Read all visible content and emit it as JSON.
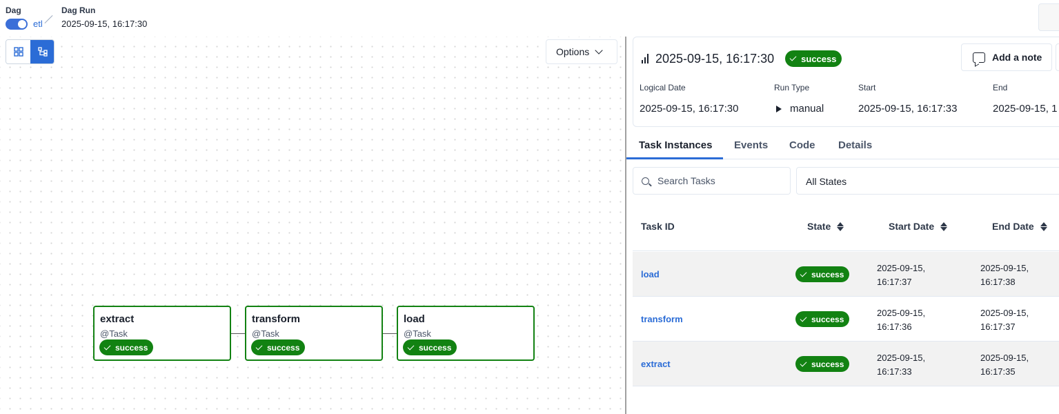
{
  "breadcrumb": {
    "dag_label": "Dag",
    "dag_id": "etl",
    "run_label": "Dag Run",
    "run_value": "2025-09-15, 16:17:30"
  },
  "graph": {
    "options_label": "Options",
    "nodes": [
      {
        "name": "extract",
        "operator": "@Task",
        "state": "success"
      },
      {
        "name": "transform",
        "operator": "@Task",
        "state": "success"
      },
      {
        "name": "load",
        "operator": "@Task",
        "state": "success"
      }
    ]
  },
  "run": {
    "title": "2025-09-15, 16:17:30",
    "state": "success",
    "add_note_label": "Add a note",
    "meta": {
      "logical_date_label": "Logical Date",
      "logical_date": "2025-09-15, 16:17:30",
      "run_type_label": "Run Type",
      "run_type": "manual",
      "start_label": "Start",
      "start": "2025-09-15, 16:17:33",
      "end_label": "End",
      "end": "2025-09-15, 1"
    }
  },
  "tabs": [
    {
      "label": "Task Instances",
      "active": true
    },
    {
      "label": "Events"
    },
    {
      "label": "Code"
    },
    {
      "label": "Details"
    }
  ],
  "filters": {
    "search_placeholder": "Search Tasks",
    "state_value": "All States"
  },
  "table": {
    "headers": {
      "task_id": "Task ID",
      "state": "State",
      "start_date": "Start Date",
      "end_date": "End Date"
    },
    "rows": [
      {
        "task_id": "load",
        "state": "success",
        "start_date": "2025-09-15,",
        "start_time": "16:17:37",
        "end_date": "2025-09-15,",
        "end_time": "16:17:38"
      },
      {
        "task_id": "transform",
        "state": "success",
        "start_date": "2025-09-15,",
        "start_time": "16:17:36",
        "end_date": "2025-09-15,",
        "end_time": "16:17:37"
      },
      {
        "task_id": "extract",
        "state": "success",
        "start_date": "2025-09-15,",
        "start_time": "16:17:33",
        "end_date": "2025-09-15,",
        "end_time": "16:17:35"
      }
    ]
  },
  "colors": {
    "accent": "#2b6cd6",
    "success": "#128212"
  }
}
